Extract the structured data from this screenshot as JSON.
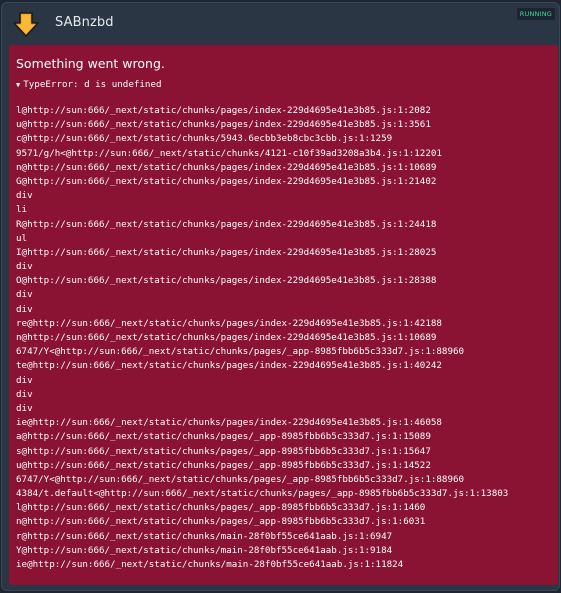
{
  "header": {
    "title": "SABnzbd",
    "status": "RUNNING",
    "icon": "sabnzbd-download-arrow-icon",
    "accent_color": "#f5a623"
  },
  "error": {
    "title": "Something went wrong.",
    "toggle_glyph": "▼",
    "summary": "TypeError: d is undefined",
    "background_color": "#8a1334",
    "stack": [
      "l@http://sun:666/_next/static/chunks/pages/index-229d4695e41e3b85.js:1:2082",
      "u@http://sun:666/_next/static/chunks/pages/index-229d4695e41e3b85.js:1:3561",
      "c@http://sun:666/_next/static/chunks/5943.6ecbb3eb8cbc3cbb.js:1:1259",
      "9571/g/h<@http://sun:666/_next/static/chunks/4121-c10f39ad3208a3b4.js:1:12201",
      "n@http://sun:666/_next/static/chunks/pages/index-229d4695e41e3b85.js:1:10689",
      "G@http://sun:666/_next/static/chunks/pages/index-229d4695e41e3b85.js:1:21402",
      "div",
      "li",
      "R@http://sun:666/_next/static/chunks/pages/index-229d4695e41e3b85.js:1:24418",
      "ul",
      "I@http://sun:666/_next/static/chunks/pages/index-229d4695e41e3b85.js:1:28025",
      "div",
      "O@http://sun:666/_next/static/chunks/pages/index-229d4695e41e3b85.js:1:28388",
      "div",
      "div",
      "re@http://sun:666/_next/static/chunks/pages/index-229d4695e41e3b85.js:1:42188",
      "n@http://sun:666/_next/static/chunks/pages/index-229d4695e41e3b85.js:1:10689",
      "6747/Y<@http://sun:666/_next/static/chunks/pages/_app-8985fbb6b5c333d7.js:1:88960",
      "te@http://sun:666/_next/static/chunks/pages/index-229d4695e41e3b85.js:1:40242",
      "div",
      "div",
      "div",
      "ie@http://sun:666/_next/static/chunks/pages/index-229d4695e41e3b85.js:1:46058",
      "a@http://sun:666/_next/static/chunks/pages/_app-8985fbb6b5c333d7.js:1:15089",
      "s@http://sun:666/_next/static/chunks/pages/_app-8985fbb6b5c333d7.js:1:15647",
      "u@http://sun:666/_next/static/chunks/pages/_app-8985fbb6b5c333d7.js:1:14522",
      "6747/Y<@http://sun:666/_next/static/chunks/pages/_app-8985fbb6b5c333d7.js:1:88960",
      "4384/t.default<@http://sun:666/_next/static/chunks/pages/_app-8985fbb6b5c333d7.js:1:13803",
      "l@http://sun:666/_next/static/chunks/pages/_app-8985fbb6b5c333d7.js:1:1460",
      "n@http://sun:666/_next/static/chunks/pages/_app-8985fbb6b5c333d7.js:1:6031",
      "r@http://sun:666/_next/static/chunks/main-28f0bf55ce641aab.js:1:6947",
      "Y@http://sun:666/_next/static/chunks/main-28f0bf55ce641aab.js:1:9184",
      "ie@http://sun:666/_next/static/chunks/main-28f0bf55ce641aab.js:1:11824"
    ]
  }
}
